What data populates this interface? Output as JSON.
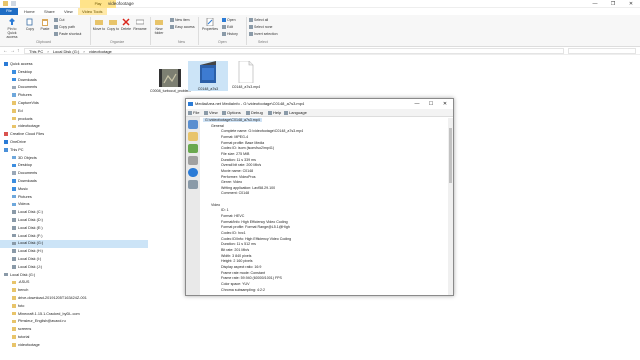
{
  "explorer": {
    "title": "videofootage",
    "context_tab_label": "Play",
    "tabs": [
      "File",
      "Home",
      "Share",
      "View",
      "Video Tools"
    ],
    "window_controls": [
      "—",
      "❐",
      "✕"
    ],
    "ribbon": {
      "clipboard": {
        "pin_label": "Pin to Quick access",
        "copy_label": "Copy",
        "paste_label": "Paste",
        "cut_label": "Cut",
        "copy_path_label": "Copy path",
        "paste_shortcut_label": "Paste shortcut",
        "group_label": "Clipboard"
      },
      "organize": {
        "move_label": "Move to",
        "copy_to_label": "Copy to",
        "delete_label": "Delete",
        "rename_label": "Rename",
        "group_label": "Organize"
      },
      "new": {
        "new_folder_label": "New folder",
        "new_item_label": "New item",
        "easy_access_label": "Easy access",
        "group_label": "New"
      },
      "open": {
        "properties_label": "Properties",
        "open_label": "Open",
        "edit_label": "Edit",
        "history_label": "History",
        "group_label": "Open"
      },
      "select": {
        "select_all_label": "Select all",
        "select_none_label": "Select none",
        "invert_label": "Invert selection",
        "group_label": "Select"
      }
    },
    "address": {
      "crumbs": [
        "This PC",
        "›",
        "Local Disk (G:)",
        "›",
        "videofootage"
      ]
    },
    "nav": [
      {
        "label": "Quick access",
        "indent": 0,
        "icon": "star-icon",
        "color": "#2b7bd6"
      },
      {
        "label": "Desktop",
        "indent": 1,
        "icon": "folder-icon",
        "color": "#3c8ee0"
      },
      {
        "label": "Downloads",
        "indent": 1,
        "icon": "download-icon",
        "color": "#3c8ee0"
      },
      {
        "label": "Documents",
        "indent": 1,
        "icon": "folder-icon",
        "color": "#9aa8b8"
      },
      {
        "label": "Pictures",
        "indent": 1,
        "icon": "folder-icon",
        "color": "#6fa8dc"
      },
      {
        "label": "CaptureVids",
        "indent": 1,
        "icon": "folder-icon",
        "color": "#e8c46a"
      },
      {
        "label": "Ed",
        "indent": 1,
        "icon": "folder-icon",
        "color": "#e8c46a"
      },
      {
        "label": "products",
        "indent": 1,
        "icon": "folder-icon",
        "color": "#e8c46a"
      },
      {
        "label": "videofootage",
        "indent": 1,
        "icon": "folder-icon",
        "color": "#e8c46a"
      },
      {
        "label": "Creative Cloud Files",
        "indent": 0,
        "icon": "cloud-icon",
        "color": "#d9534f"
      },
      {
        "label": "OneDrive",
        "indent": 0,
        "icon": "cloud-icon",
        "color": "#2b7bd6"
      },
      {
        "label": "This PC",
        "indent": 0,
        "icon": "computer-icon",
        "color": "#4a90d9"
      },
      {
        "label": "3D Objects",
        "indent": 1,
        "icon": "folder-icon",
        "color": "#6fa8dc"
      },
      {
        "label": "Desktop",
        "indent": 1,
        "icon": "folder-icon",
        "color": "#3c8ee0"
      },
      {
        "label": "Documents",
        "indent": 1,
        "icon": "folder-icon",
        "color": "#9aa8b8"
      },
      {
        "label": "Downloads",
        "indent": 1,
        "icon": "download-icon",
        "color": "#3c8ee0"
      },
      {
        "label": "Music",
        "indent": 1,
        "icon": "music-icon",
        "color": "#3c8ee0"
      },
      {
        "label": "Pictures",
        "indent": 1,
        "icon": "folder-icon",
        "color": "#6fa8dc"
      },
      {
        "label": "Videos",
        "indent": 1,
        "icon": "folder-icon",
        "color": "#6fa8dc"
      },
      {
        "label": "Local Disk (C:)",
        "indent": 1,
        "icon": "drive-icon",
        "color": "#8a9aa8"
      },
      {
        "label": "Local Disk (D:)",
        "indent": 1,
        "icon": "drive-icon",
        "color": "#8a9aa8"
      },
      {
        "label": "Local Disk (E:)",
        "indent": 1,
        "icon": "drive-icon",
        "color": "#8a9aa8"
      },
      {
        "label": "Local Disk (F:)",
        "indent": 1,
        "icon": "drive-icon",
        "color": "#8a9aa8"
      },
      {
        "label": "Local Disk (G:)",
        "indent": 1,
        "icon": "drive-icon",
        "color": "#8a9aa8",
        "selected": true
      },
      {
        "label": "Local Disk (H:)",
        "indent": 1,
        "icon": "drive-icon",
        "color": "#8a9aa8"
      },
      {
        "label": "Local Disk (I:)",
        "indent": 1,
        "icon": "drive-icon",
        "color": "#8a9aa8"
      },
      {
        "label": "Local Disk (J:)",
        "indent": 1,
        "icon": "drive-icon",
        "color": "#8a9aa8"
      },
      {
        "label": "Local Disk (G:)",
        "indent": 0,
        "icon": "drive-icon",
        "color": "#8a9aa8"
      },
      {
        "label": ".ASUS",
        "indent": 1,
        "icon": "folder-icon",
        "color": "#e8c46a"
      },
      {
        "label": "bench",
        "indent": 1,
        "icon": "folder-icon",
        "color": "#e8c46a"
      },
      {
        "label": "drive-download-20191205T163424Z-001",
        "indent": 1,
        "icon": "folder-icon",
        "color": "#e8c46a"
      },
      {
        "label": "foto",
        "indent": 1,
        "icon": "folder-icon",
        "color": "#e8c46a"
      },
      {
        "label": "Minecraft.1.15.1.Cracked_byDL.com",
        "indent": 1,
        "icon": "folder-icon",
        "color": "#e8c46a"
      },
      {
        "label": "Pimsleur_English@avaxd.ru",
        "indent": 1,
        "icon": "folder-icon",
        "color": "#e8c46a"
      },
      {
        "label": "screens",
        "indent": 1,
        "icon": "folder-icon",
        "color": "#e8c46a"
      },
      {
        "label": "tutorial",
        "indent": 1,
        "icon": "folder-icon",
        "color": "#e8c46a"
      },
      {
        "label": "videofootage",
        "indent": 1,
        "icon": "folder-icon",
        "color": "#e8c46a"
      }
    ],
    "files": [
      {
        "name": "C0008_turbocut_problem",
        "kind": "video"
      },
      {
        "name": "C0148_a7s3",
        "kind": "clapper"
      },
      {
        "name": "C0148_a7s3.mp4",
        "kind": "doc"
      }
    ]
  },
  "mediainfo": {
    "title": "MediaArea.net MediaInfo - G:\\videofootage\\C0148_a7s3.mp4",
    "window_controls": [
      "—",
      "☐",
      "✕"
    ],
    "menu": [
      "File",
      "View",
      "Options",
      "Debug",
      "Help",
      "Language"
    ],
    "sidebar_icons": [
      "open-file-icon",
      "open-folder-icon",
      "export-icon",
      "about-icon",
      "info-icon",
      "settings-icon"
    ],
    "rows": [
      {
        "text": "G:\\videofootage\\C0148_a7s3.mp4",
        "indent": 0,
        "path": true
      },
      {
        "text": "General",
        "indent": 1
      },
      {
        "text": "Complete name: G:\\videofootage\\C0148_a7s3.mp4",
        "indent": 2
      },
      {
        "text": "Format: MPEG-4",
        "indent": 2
      },
      {
        "text": "Format profile: Base Media",
        "indent": 2
      },
      {
        "text": "Codec ID: isom (isom/iso2/mp41)",
        "indent": 2
      },
      {
        "text": "File size: 275 MiB",
        "indent": 2
      },
      {
        "text": "Duration: 11 s 339 ms",
        "indent": 2
      },
      {
        "text": "Overall bit rate: 200 Mb/s",
        "indent": 2
      },
      {
        "text": "Movie name: C0148",
        "indent": 2
      },
      {
        "text": "Performer: VideoPros",
        "indent": 2
      },
      {
        "text": "Genre: Video",
        "indent": 2
      },
      {
        "text": "Writing application: Lavf58.29.100",
        "indent": 2
      },
      {
        "text": "Comment: C0148",
        "indent": 2
      },
      {
        "text": "",
        "indent": 2
      },
      {
        "text": "Video",
        "indent": 1
      },
      {
        "text": "ID: 1",
        "indent": 2
      },
      {
        "text": "Format: HEVC",
        "indent": 2
      },
      {
        "text": "Format/Info: High Efficiency Video Coding",
        "indent": 2
      },
      {
        "text": "Format profile: Format Range@L5.1@High",
        "indent": 2
      },
      {
        "text": "Codec ID: hvc1",
        "indent": 2
      },
      {
        "text": "Codec ID/Info: High Efficiency Video Coding",
        "indent": 2
      },
      {
        "text": "Duration: 11 s 512 ms",
        "indent": 2
      },
      {
        "text": "Bit rate: 201 Mb/s",
        "indent": 2
      },
      {
        "text": "Width: 3 840 pixels",
        "indent": 2
      },
      {
        "text": "Height: 2 160 pixels",
        "indent": 2
      },
      {
        "text": "Display aspect ratio: 16:9",
        "indent": 2
      },
      {
        "text": "Frame rate mode: Constant",
        "indent": 2
      },
      {
        "text": "Frame rate: 59.940 (60000/1001) FPS",
        "indent": 2
      },
      {
        "text": "Color space: YUV",
        "indent": 2
      },
      {
        "text": "Chroma subsampling: 4:2:2",
        "indent": 2
      }
    ]
  },
  "colors": {
    "accent": "#1e6cc4",
    "selection": "#cce4f7",
    "play_tab": "#ffe38a"
  }
}
